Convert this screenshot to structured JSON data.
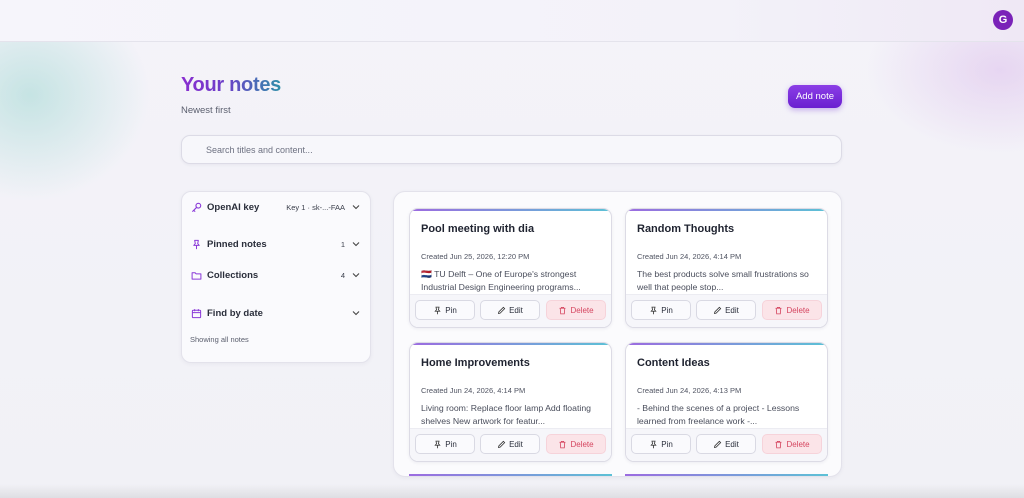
{
  "header": {
    "avatar_initial": "G"
  },
  "page": {
    "title": "Your notes",
    "subtitle": "Newest first",
    "add_button": "Add note"
  },
  "search": {
    "placeholder": "Search titles and content..."
  },
  "sidebar": {
    "openai": {
      "label": "OpenAI key",
      "value": "Key 1 · sk-...-FAA"
    },
    "pinned": {
      "label": "Pinned notes",
      "count": "1"
    },
    "collections": {
      "label": "Collections",
      "count": "4"
    },
    "date": {
      "label": "Find by date",
      "status": "Showing all notes"
    }
  },
  "actions": {
    "pin": "Pin",
    "edit": "Edit",
    "delete": "Delete"
  },
  "notes": [
    {
      "title": "Pool meeting with dia",
      "created": "Created Jun 25, 2026, 12:20 PM",
      "body": "🇳🇱 TU Delft – One of Europe's strongest Industrial Design Engineering programs..."
    },
    {
      "title": "Random Thoughts",
      "created": "Created Jun 24, 2026, 4:14 PM",
      "body": "The best products solve small frustrations so well that people stop..."
    },
    {
      "title": "Home Improvements",
      "created": "Created Jun 24, 2026, 4:14 PM",
      "body": "Living room: Replace floor lamp Add floating shelves New artwork for featur..."
    },
    {
      "title": "Content Ideas",
      "created": "Created Jun 24, 2026, 4:13 PM",
      "body": "- Behind the scenes of a project - Lessons learned from freelance work -..."
    }
  ],
  "colors": {
    "accent": "#7a2ee0",
    "delete": "#d5455f",
    "avatar": "#7a22b8"
  }
}
